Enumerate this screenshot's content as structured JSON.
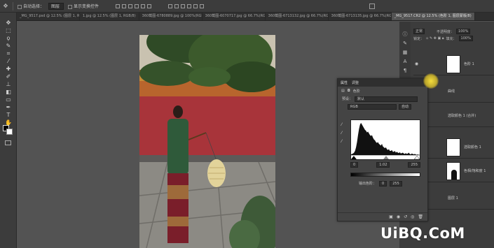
{
  "options_bar": {
    "auto_select_label": "自动选择：",
    "auto_select_target": "图层",
    "show_transform_label": "显示变换控件"
  },
  "tabs": [
    {
      "label": "_MG_9517.psd @ 12.5% (图层 1, RGB/8)",
      "active": false
    },
    {
      "label": "1.jpg @ 12.5% (图层 1, RGB/8)",
      "active": false
    },
    {
      "label": "360截图-6780889.jpg @ 100%(RGB/8)",
      "active": false
    },
    {
      "label": "360截图-6070717.jpg @ 66.7%(RGB/8)",
      "active": false
    },
    {
      "label": "360截图-6713132.jpg @ 66.7%(RGB/8)",
      "active": false
    },
    {
      "label": "360截图-6713135.jpg @ 66.7%(RGB/8)",
      "active": false
    },
    {
      "label": "_MG_9517.CR2 @ 12.5% (色阶 1, 图层蒙版/8)",
      "active": true
    }
  ],
  "layers_panel": {
    "blend_mode": "正常",
    "opacity_label": "不透明度：",
    "opacity_value": "100%",
    "lock_label": "锁定：",
    "fill_label": "填充：",
    "fill_value": "100%",
    "layers": [
      {
        "name": "色阶 1"
      },
      {
        "name": "曲线"
      },
      {
        "name": "选取颜色 1 (合并)"
      },
      {
        "name": "选取颜色 1"
      },
      {
        "name": "色相/饱和度 1"
      },
      {
        "name": "图层 1"
      }
    ]
  },
  "properties": {
    "tab_properties": "属性",
    "tab_adjust": "调整",
    "title": "色阶",
    "preset_label": "预设：",
    "preset_value": "默认",
    "channel_value": "RGB",
    "auto_label": "自动",
    "input_black": "0",
    "input_gamma": "1.02",
    "input_white": "255",
    "output_label": "输出色阶：",
    "output_black": "0",
    "output_white": "255"
  },
  "histogram": [
    2,
    3,
    4,
    6,
    10,
    18,
    30,
    46,
    60,
    70,
    74,
    70,
    66,
    62,
    58,
    56,
    52,
    54,
    50,
    46,
    44,
    46,
    40,
    36,
    34,
    30,
    28,
    30,
    26,
    24,
    22,
    26,
    20,
    18,
    16,
    18,
    14,
    12,
    14,
    10,
    10,
    12,
    8,
    8,
    10,
    6,
    8,
    6,
    5,
    7,
    4,
    5,
    6,
    4,
    3,
    5,
    3,
    4,
    6,
    3,
    2,
    4,
    3,
    2,
    3,
    2,
    1,
    2,
    1,
    1
  ],
  "watermark": "UiBQ.CoM",
  "colors": {
    "foreground": "#000000",
    "background": "#ffffff",
    "cursor_highlight": "#f2d52b"
  }
}
